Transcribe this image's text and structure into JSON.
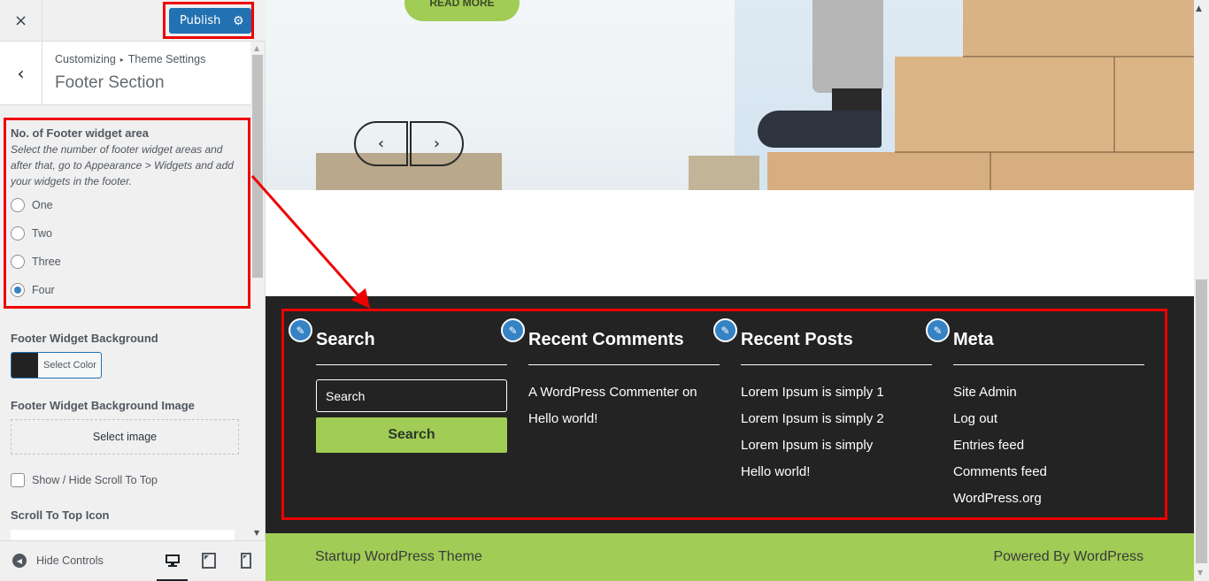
{
  "sidebar": {
    "close_icon": "×",
    "publish_label": "Publish",
    "gear_icon": "⚙",
    "back_icon": "‹",
    "breadcrumb": {
      "parent": "Customizing",
      "separator": "▸",
      "current": "Theme Settings"
    },
    "section_title": "Footer Section",
    "footer_widget_area": {
      "label": "No. of Footer widget area",
      "description": "Select the number of footer widget areas and after that, go to Appearance > Widgets and add your widgets in the footer.",
      "options": [
        {
          "label": "One",
          "checked": false
        },
        {
          "label": "Two",
          "checked": false
        },
        {
          "label": "Three",
          "checked": false
        },
        {
          "label": "Four",
          "checked": true
        }
      ]
    },
    "widget_background": {
      "label": "Footer Widget Background",
      "button_label": "Select Color",
      "color": "#222222"
    },
    "widget_background_image": {
      "label": "Footer Widget Background Image",
      "button_label": "Select image"
    },
    "scroll_to_top_toggle": {
      "label": "Show / Hide Scroll To Top",
      "checked": false
    },
    "scroll_to_top_icon": {
      "label": "Scroll To Top Icon"
    },
    "hide_controls_label": "Hide Controls",
    "devices": [
      "desktop",
      "tablet",
      "mobile"
    ],
    "active_device": "desktop"
  },
  "preview": {
    "read_more_label": "READ MORE",
    "slider_prev_icon": "‹",
    "slider_next_icon": "›",
    "widgets": [
      {
        "title": "Search",
        "type": "search",
        "input_placeholder": "Search",
        "button_label": "Search"
      },
      {
        "title": "Recent Comments",
        "type": "list",
        "items": [
          "A WordPress Commenter on",
          "Hello world!"
        ]
      },
      {
        "title": "Recent Posts",
        "type": "list",
        "items": [
          "Lorem Ipsum is simply 1",
          "Lorem Ipsum is simply 2",
          "Lorem Ipsum is simply",
          "Hello world!"
        ]
      },
      {
        "title": "Meta",
        "type": "list",
        "items": [
          "Site Admin",
          "Log out",
          "Entries feed",
          "Comments feed",
          "WordPress.org"
        ]
      }
    ],
    "copyright_left": "Startup WordPress Theme",
    "copyright_right": "Powered By WordPress"
  },
  "colors": {
    "accent_green": "#a1cc55",
    "wp_blue": "#2271b1",
    "footer_dark": "#232323",
    "annotation_red": "#ee0000"
  }
}
